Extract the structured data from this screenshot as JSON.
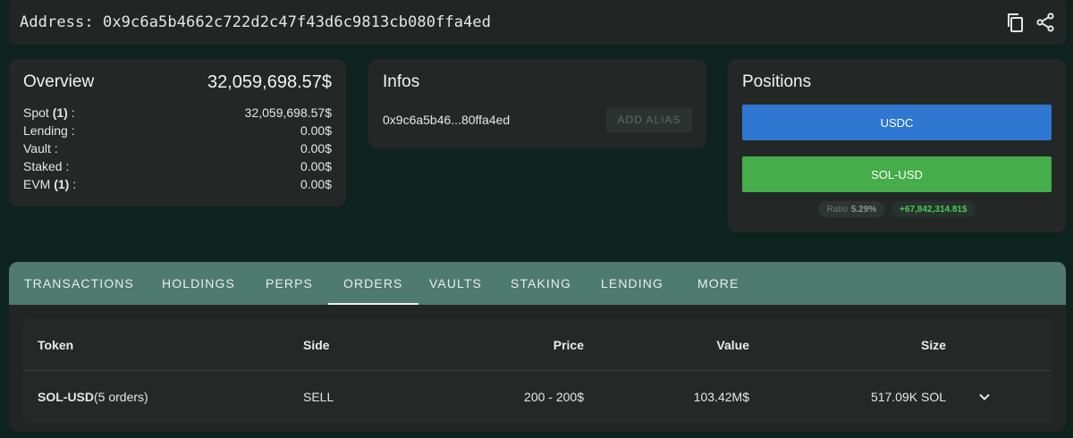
{
  "address_bar": {
    "label": "Address: 0x9c6a5b4662c722d2c47f43d6c9813cb080ffa4ed",
    "icons": [
      "copy-icon",
      "share-icon"
    ]
  },
  "overview": {
    "title": "Overview",
    "total": "32,059,698.57$",
    "rows": [
      {
        "label": "Spot",
        "count": "(1)",
        "suffix": " :",
        "value": "32,059,698.57$"
      },
      {
        "label": "Lending :",
        "count": "",
        "suffix": "",
        "value": "0.00$"
      },
      {
        "label": "Vault :",
        "count": "",
        "suffix": "",
        "value": "0.00$"
      },
      {
        "label": "Staked :",
        "count": "",
        "suffix": "",
        "value": "0.00$"
      },
      {
        "label": "EVM",
        "count": "(1)",
        "suffix": " :",
        "value": "0.00$"
      }
    ]
  },
  "infos": {
    "title": "Infos",
    "short_address": "0x9c6a5b46...80ffa4ed",
    "alias_button": "ADD ALIAS"
  },
  "positions": {
    "title": "Positions",
    "bars": [
      {
        "label": "USDC",
        "color": "#2f77d1"
      },
      {
        "label": "SOL-USD",
        "color": "#45ad4a"
      }
    ],
    "ratio_label": "Ratio",
    "ratio_value": "5.29%",
    "pnl": "+67,842,314.81$"
  },
  "tabs": [
    {
      "label": "TRANSACTIONS",
      "active": false
    },
    {
      "label": "HOLDINGS",
      "active": false
    },
    {
      "label": "PERPS",
      "active": false
    },
    {
      "label": "ORDERS",
      "active": true
    },
    {
      "label": "VAULTS",
      "active": false
    },
    {
      "label": "STAKING",
      "active": false
    },
    {
      "label": "LENDING",
      "active": false
    },
    {
      "label": "MORE",
      "active": false
    }
  ],
  "orders_table": {
    "headers": {
      "token": "Token",
      "side": "Side",
      "price": "Price",
      "value": "Value",
      "size": "Size"
    },
    "rows": [
      {
        "token": "SOL-USD",
        "token_note": "(5 orders)",
        "side": "SELL",
        "price": "200 - 200$",
        "value": "103.42M$",
        "size": "517.09K SOL"
      }
    ]
  },
  "colors": {
    "background": "#0f231e",
    "card": "#232826",
    "tab_bar": "#4e7a70",
    "sell": "#e0312f",
    "pnl": "#4ec65a"
  }
}
